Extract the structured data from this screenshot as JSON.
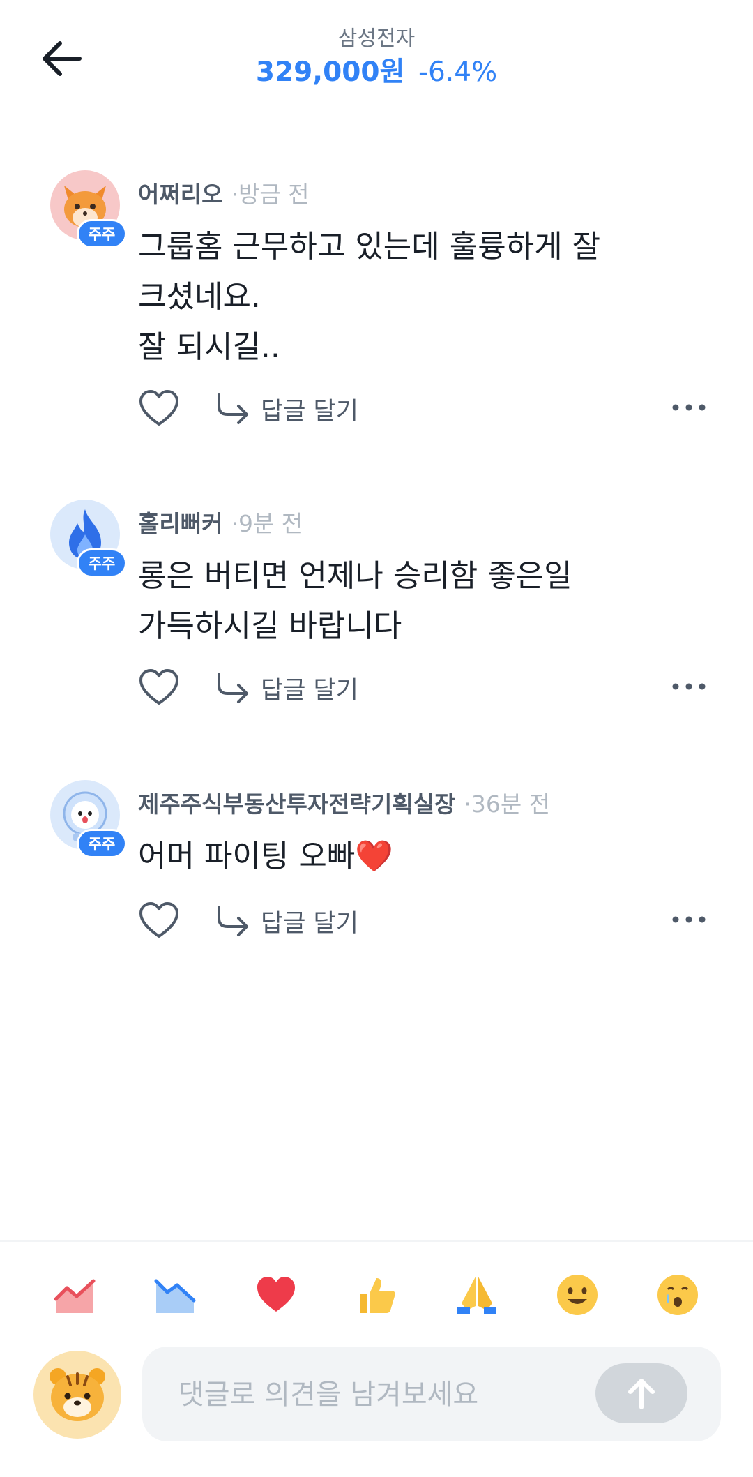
{
  "header": {
    "stock_name": "삼성전자",
    "price": "329,000원",
    "change": "-6.4%",
    "price_color": "#3182f6"
  },
  "comments": [
    {
      "author": "어쩌리오",
      "time": "·방금 전",
      "badge": "주주",
      "avatar_icon": "fox-icon",
      "lines": [
        "그룹홈 근무하고 있는데 훌륭하게 잘",
        "크셨네요.",
        "잘 되시길.."
      ],
      "reply_label": "답글 달기"
    },
    {
      "author": "홀리뻐커",
      "time": "·9분 전",
      "badge": "주주",
      "avatar_icon": "flame-icon",
      "lines": [
        "롱은 버티면 언제나 승리함 좋은일",
        "가득하시길 바랍니다"
      ],
      "reply_label": "답글 달기"
    },
    {
      "author": "제주주식부동산투자전략기획실장",
      "time": "·36분 전",
      "badge": "주주",
      "avatar_icon": "astronaut-icon",
      "lines": [
        "어머  파이팅 오빠❤️"
      ],
      "reply_label": "답글 달기"
    }
  ],
  "emoji_bar": [
    "chart-up-icon",
    "chart-down-icon",
    "heart-icon",
    "thumbs-up-icon",
    "pray-icon",
    "smile-icon",
    "cry-icon"
  ],
  "composer": {
    "placeholder": "댓글로 의견을 남겨보세요",
    "my_avatar_icon": "tiger-icon"
  }
}
